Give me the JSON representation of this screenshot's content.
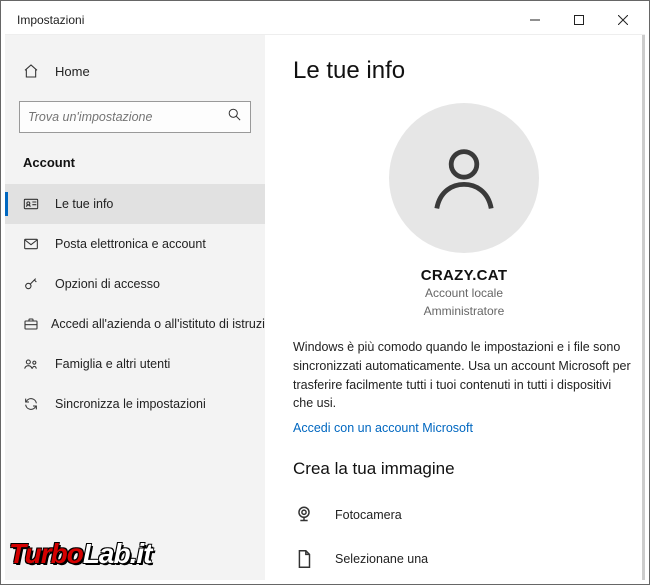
{
  "window": {
    "title": "Impostazioni"
  },
  "sidebar": {
    "home": "Home",
    "search_placeholder": "Trova un'impostazione",
    "category": "Account",
    "items": [
      {
        "label": "Le tue info"
      },
      {
        "label": "Posta elettronica e account"
      },
      {
        "label": "Opzioni di accesso"
      },
      {
        "label": "Accedi all'azienda o all'istituto di istruzione"
      },
      {
        "label": "Famiglia e altri utenti"
      },
      {
        "label": "Sincronizza le impostazioni"
      }
    ]
  },
  "main": {
    "heading": "Le tue info",
    "username": "CRAZY.CAT",
    "account_type": "Account locale",
    "role": "Amministratore",
    "desc": "Windows è più comodo quando le impostazioni e i file sono sincronizzati automaticamente. Usa un account Microsoft per trasferire facilmente tutti i tuoi contenuti in tutti i dispositivi che usi.",
    "ms_link": "Accedi con un account Microsoft",
    "create_image": {
      "heading": "Crea la tua immagine",
      "camera": "Fotocamera",
      "browse": "Selezionane una"
    }
  },
  "watermark": {
    "part1": "Turbo",
    "part2": "Lab.it"
  }
}
